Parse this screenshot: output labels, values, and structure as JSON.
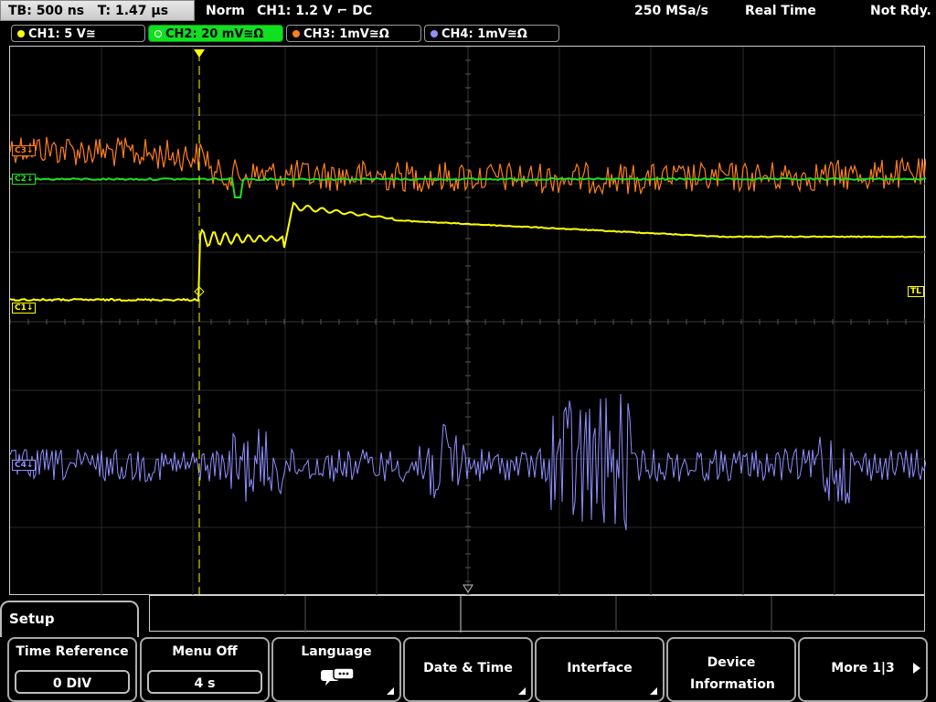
{
  "topbar": {
    "tb_label": "TB: 500 ns",
    "t_label": "T: 1.47 µs",
    "mode": "Norm",
    "trigger": "CH1: 1.2 V ⌐ DC",
    "sample_rate": "250 MSa/s",
    "acq_mode": "Real Time",
    "status": "Not Rdy."
  },
  "channels": [
    {
      "label": "CH1: 5 V≅",
      "color": "#ffff00",
      "active": false
    },
    {
      "label": "CH2: 20 mV≅Ω",
      "color": "#1fe01f",
      "active": true
    },
    {
      "label": "CH3: 1mV≅Ω",
      "color": "#ff7f1f",
      "active": false
    },
    {
      "label": "CH4: 1mV≅Ω",
      "color": "#8f8fff",
      "active": false
    }
  ],
  "markers": {
    "c1": "C1↓",
    "c2": "C2↓",
    "c3": "C3↓",
    "c4": "C4↓",
    "tl": "TL",
    "trigger_top": "T"
  },
  "menu": {
    "title": "Setup",
    "softkeys": [
      {
        "label": "Time Reference",
        "value": "0 DIV"
      },
      {
        "label": "Menu Off",
        "value": "4 s"
      },
      {
        "label": "Language",
        "value": ""
      },
      {
        "label": "Date & Time",
        "value": ""
      },
      {
        "label": "Interface",
        "value": ""
      },
      {
        "label": "Device Information",
        "value": ""
      },
      {
        "label": "More 1|3",
        "value": ""
      }
    ]
  }
}
